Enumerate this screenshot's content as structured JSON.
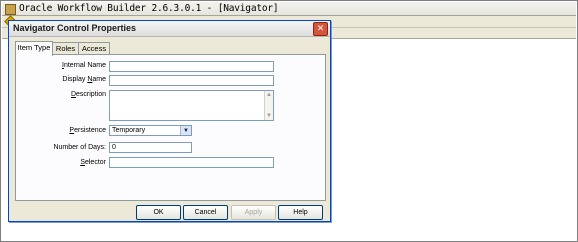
{
  "app": {
    "title": "Oracle Workflow Builder 2.6.3.0.1 - [Navigator]"
  },
  "dialog": {
    "title": "Navigator Control Properties",
    "close_label": "✕",
    "tabs": [
      {
        "label": "Item Type"
      },
      {
        "label": "Roles"
      },
      {
        "label": "Access"
      }
    ],
    "fields": {
      "internal_name": {
        "label": "Internal Name",
        "mnemonic": "I",
        "rest": "nternal Name",
        "value": ""
      },
      "display_name": {
        "label": "Display Name",
        "mnemonic": "N",
        "pre": "Display ",
        "rest": "ame",
        "value": ""
      },
      "description": {
        "label": "Description",
        "mnemonic": "D",
        "rest": "escription",
        "value": ""
      },
      "persistence": {
        "label": "Persistence",
        "mnemonic": "P",
        "rest": "ersistence",
        "value": "Temporary"
      },
      "number_of_days": {
        "label": "Number of Days:",
        "value": "0"
      },
      "selector": {
        "label": "Selector",
        "mnemonic": "S",
        "rest": "elector",
        "value": ""
      }
    },
    "buttons": {
      "ok": "OK",
      "cancel": "Cancel",
      "apply": "Apply",
      "help": "Help"
    }
  }
}
